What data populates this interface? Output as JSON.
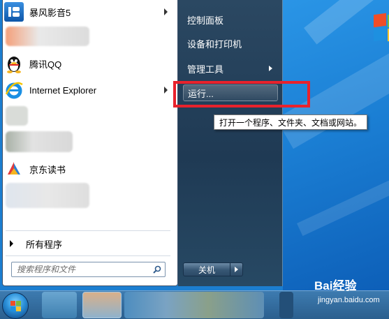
{
  "start_menu": {
    "pinned_programs": [
      {
        "label": "暴风影音5",
        "icon": "baofeng-icon",
        "has_submenu": true
      },
      {
        "label": "腾讯QQ",
        "icon": "qq-penguin-icon",
        "has_submenu": false
      },
      {
        "label": "Internet Explorer",
        "icon": "internet-explorer-icon",
        "has_submenu": true
      },
      {
        "label": "京东读书",
        "icon": "jd-reading-icon",
        "has_submenu": false
      }
    ],
    "all_programs_label": "所有程序",
    "search": {
      "placeholder": "搜索程序和文件"
    },
    "right_pane": {
      "items": [
        {
          "label": "控制面板",
          "has_submenu": false
        },
        {
          "label": "设备和打印机",
          "has_submenu": false
        },
        {
          "label": "管理工具",
          "has_submenu": true
        },
        {
          "label": "运行...",
          "has_submenu": false,
          "active": true
        }
      ]
    },
    "tooltip": "打开一个程序、文件夹、文档或网站。",
    "shutdown_label": "关机"
  },
  "watermark": {
    "brand": "Bai经验",
    "url": "jingyan.baidu.com"
  },
  "colors": {
    "highlight": "#e8222c",
    "right_pane": "#1f3a54",
    "desktop": "#1b7fd4"
  }
}
